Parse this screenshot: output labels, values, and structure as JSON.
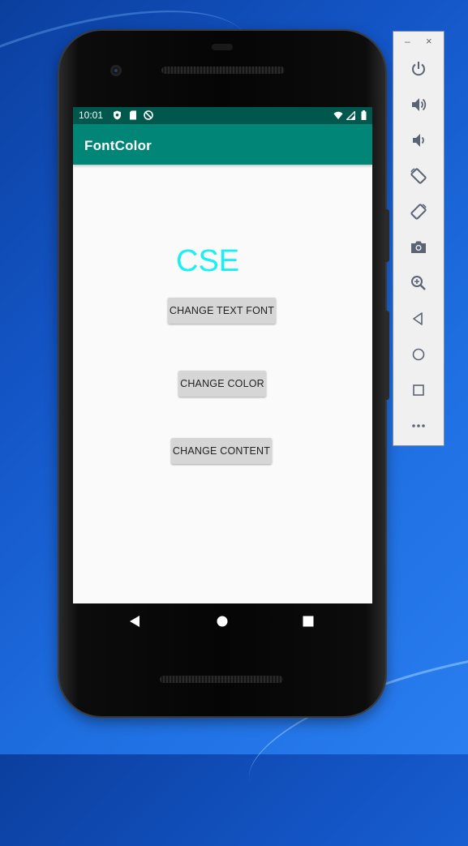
{
  "status_bar": {
    "time": "10:01",
    "left_icons": [
      "shield-icon",
      "sd-card-icon",
      "do-not-disturb-icon"
    ],
    "right_icons": [
      "wifi-icon",
      "signal-icon",
      "battery-icon"
    ]
  },
  "app": {
    "title": "FontColor",
    "display_text": "CSE",
    "display_text_color": "#19f0f5",
    "toolbar_color": "#008577",
    "status_bar_color": "#00574b"
  },
  "buttons": {
    "change_font": "CHANGE TEXT FONT",
    "change_color": "CHANGE COLOR",
    "change_content": "CHANGE CONTENT"
  },
  "nav_bar": {
    "items": [
      "back-icon",
      "home-icon",
      "recents-icon"
    ]
  },
  "emulator_panel": {
    "minimize": "–",
    "close": "×",
    "tools": [
      "power-icon",
      "volume-up-icon",
      "volume-down-icon",
      "rotate-left-icon",
      "rotate-right-icon",
      "camera-icon",
      "zoom-icon",
      "back-icon",
      "home-icon",
      "overview-icon",
      "more-icon"
    ]
  }
}
